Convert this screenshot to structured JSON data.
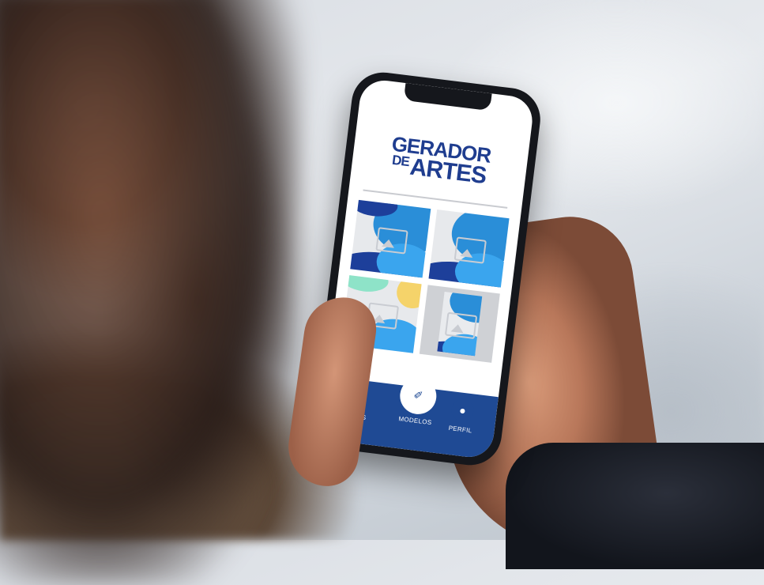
{
  "app": {
    "logo_line1": "GERADOR",
    "logo_small": "DE",
    "logo_line2": "ARTES"
  },
  "templates": [
    {
      "name": "template-1"
    },
    {
      "name": "template-2"
    },
    {
      "name": "template-3"
    },
    {
      "name": "template-4"
    }
  ],
  "nav": {
    "items": [
      {
        "label": "ARTES",
        "icon": "image-icon"
      },
      {
        "label": "MODELOS",
        "icon": "brush-icon"
      },
      {
        "label": "PERFIL",
        "icon": "user-icon"
      }
    ],
    "active": "MODELOS"
  },
  "colors": {
    "brand": "#1f3d8f",
    "nav_bg": "#1f4a94",
    "accent": "#2a8ed8"
  }
}
